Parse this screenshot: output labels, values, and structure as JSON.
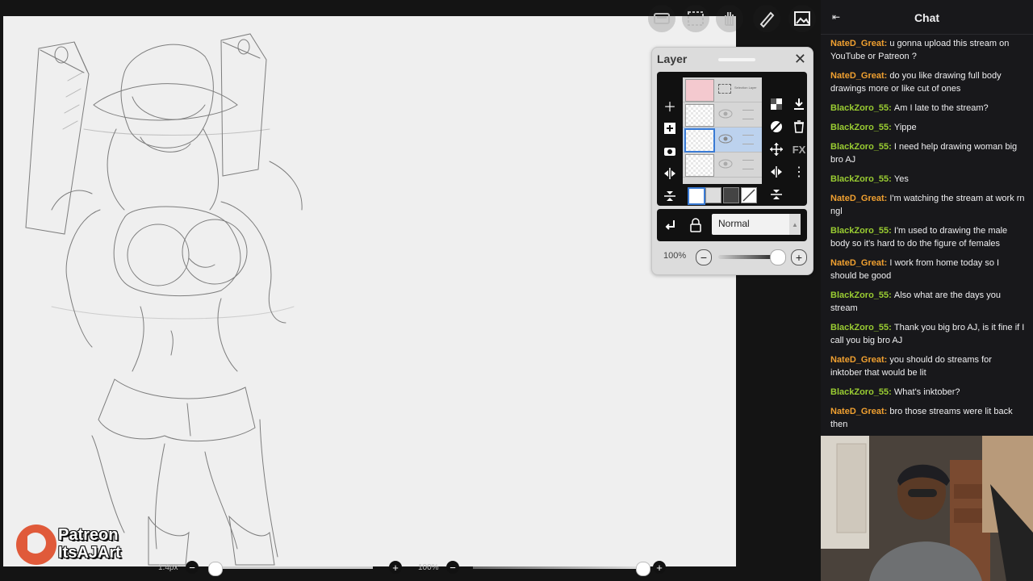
{
  "toolbar": {
    "icons": [
      "layers-icon",
      "selection-icon",
      "hand-icon",
      "pen-icon",
      "image-icon"
    ]
  },
  "layer_panel": {
    "title": "Layer",
    "close_icon": "close-icon",
    "layers": [
      {
        "name": "Selection Layer",
        "selected": false
      },
      {
        "name": "",
        "selected": false
      },
      {
        "name": "",
        "selected": true
      },
      {
        "name": "",
        "selected": false
      }
    ],
    "blend_mode": "Normal",
    "opacity": "100%"
  },
  "bottom_bar": {
    "brush_size": "1.4px",
    "brush_opacity": "100%",
    "brush_size_level": 0.02,
    "brush_opacity_level": 1.0
  },
  "watermark": {
    "line1": "Patreon",
    "line2": "ItsAJArt"
  },
  "chat": {
    "title": "Chat",
    "messages": [
      {
        "user": "NateD_Great",
        "color": "#f0a030",
        "text": "u gonna upload this stream on YouTube or Patreon ?"
      },
      {
        "user": "NateD_Great",
        "color": "#f0a030",
        "text": "do you like drawing full body drawings more or like cut of ones"
      },
      {
        "user": "BlackZoro_55",
        "color": "#9acd32",
        "text": "Am I late to the stream?"
      },
      {
        "user": "BlackZoro_55",
        "color": "#9acd32",
        "text": "Yippe"
      },
      {
        "user": "BlackZoro_55",
        "color": "#9acd32",
        "text": "I need help drawing woman big bro AJ"
      },
      {
        "user": "BlackZoro_55",
        "color": "#9acd32",
        "text": "Yes"
      },
      {
        "user": "NateD_Great",
        "color": "#f0a030",
        "text": "I'm watching the stream at work rn ngl"
      },
      {
        "user": "BlackZoro_55",
        "color": "#9acd32",
        "text": "I'm used to drawing the male body so it's hard to do the figure of females"
      },
      {
        "user": "NateD_Great",
        "color": "#f0a030",
        "text": "I work from home today so I should be good"
      },
      {
        "user": "BlackZoro_55",
        "color": "#9acd32",
        "text": "Also what are the days you stream"
      },
      {
        "user": "BlackZoro_55",
        "color": "#9acd32",
        "text": "Thank you big bro AJ, is it fine if I call you big bro AJ"
      },
      {
        "user": "NateD_Great",
        "color": "#f0a030",
        "text": "you should do streams for inktober that would be lit"
      },
      {
        "user": "BlackZoro_55",
        "color": "#9acd32",
        "text": "What's inktober?"
      },
      {
        "user": "NateD_Great",
        "color": "#f0a030",
        "text": "bro those streams were lit back then"
      }
    ]
  }
}
